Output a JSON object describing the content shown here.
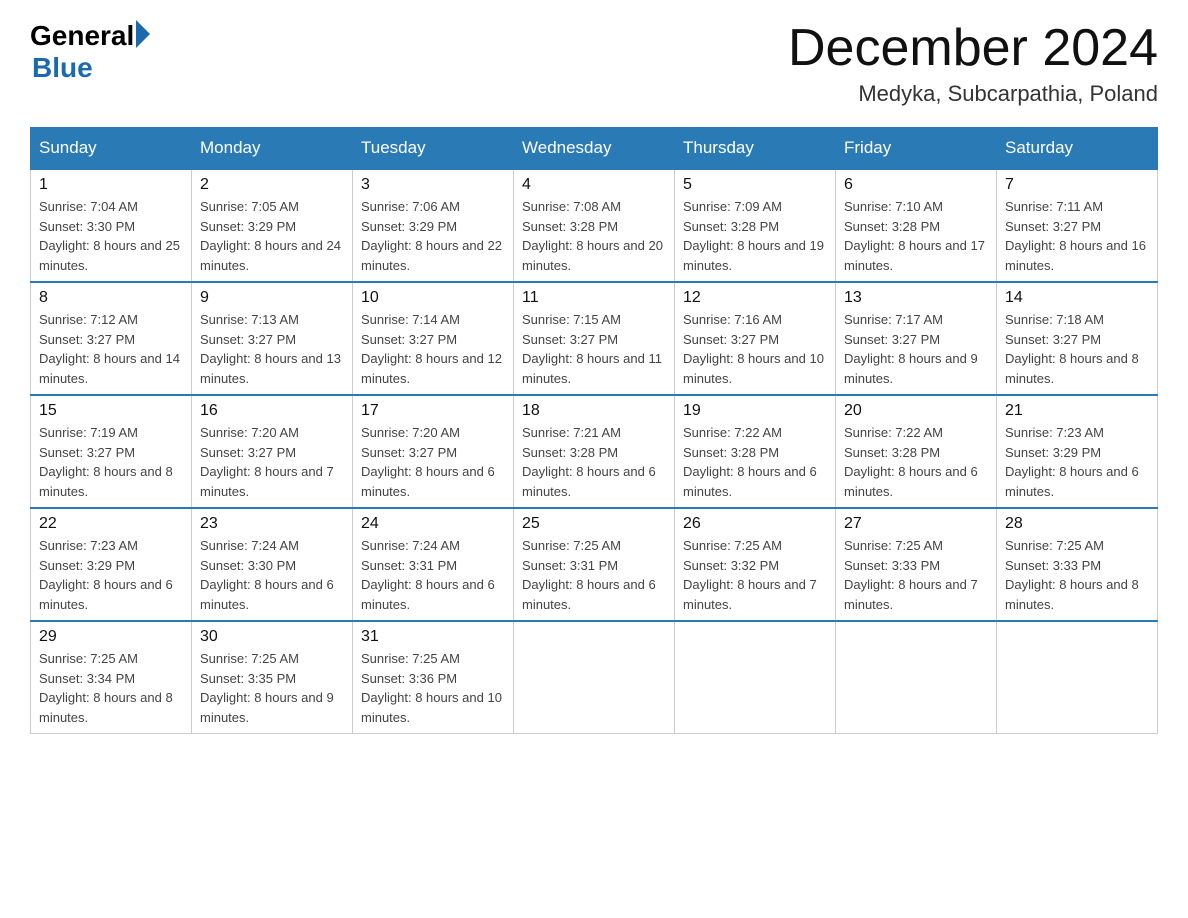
{
  "header": {
    "logo_general": "General",
    "logo_blue": "Blue",
    "month_title": "December 2024",
    "location": "Medyka, Subcarpathia, Poland"
  },
  "days_of_week": [
    "Sunday",
    "Monday",
    "Tuesday",
    "Wednesday",
    "Thursday",
    "Friday",
    "Saturday"
  ],
  "weeks": [
    [
      {
        "day": "1",
        "sunrise": "7:04 AM",
        "sunset": "3:30 PM",
        "daylight": "8 hours and 25 minutes."
      },
      {
        "day": "2",
        "sunrise": "7:05 AM",
        "sunset": "3:29 PM",
        "daylight": "8 hours and 24 minutes."
      },
      {
        "day": "3",
        "sunrise": "7:06 AM",
        "sunset": "3:29 PM",
        "daylight": "8 hours and 22 minutes."
      },
      {
        "day": "4",
        "sunrise": "7:08 AM",
        "sunset": "3:28 PM",
        "daylight": "8 hours and 20 minutes."
      },
      {
        "day": "5",
        "sunrise": "7:09 AM",
        "sunset": "3:28 PM",
        "daylight": "8 hours and 19 minutes."
      },
      {
        "day": "6",
        "sunrise": "7:10 AM",
        "sunset": "3:28 PM",
        "daylight": "8 hours and 17 minutes."
      },
      {
        "day": "7",
        "sunrise": "7:11 AM",
        "sunset": "3:27 PM",
        "daylight": "8 hours and 16 minutes."
      }
    ],
    [
      {
        "day": "8",
        "sunrise": "7:12 AM",
        "sunset": "3:27 PM",
        "daylight": "8 hours and 14 minutes."
      },
      {
        "day": "9",
        "sunrise": "7:13 AM",
        "sunset": "3:27 PM",
        "daylight": "8 hours and 13 minutes."
      },
      {
        "day": "10",
        "sunrise": "7:14 AM",
        "sunset": "3:27 PM",
        "daylight": "8 hours and 12 minutes."
      },
      {
        "day": "11",
        "sunrise": "7:15 AM",
        "sunset": "3:27 PM",
        "daylight": "8 hours and 11 minutes."
      },
      {
        "day": "12",
        "sunrise": "7:16 AM",
        "sunset": "3:27 PM",
        "daylight": "8 hours and 10 minutes."
      },
      {
        "day": "13",
        "sunrise": "7:17 AM",
        "sunset": "3:27 PM",
        "daylight": "8 hours and 9 minutes."
      },
      {
        "day": "14",
        "sunrise": "7:18 AM",
        "sunset": "3:27 PM",
        "daylight": "8 hours and 8 minutes."
      }
    ],
    [
      {
        "day": "15",
        "sunrise": "7:19 AM",
        "sunset": "3:27 PM",
        "daylight": "8 hours and 8 minutes."
      },
      {
        "day": "16",
        "sunrise": "7:20 AM",
        "sunset": "3:27 PM",
        "daylight": "8 hours and 7 minutes."
      },
      {
        "day": "17",
        "sunrise": "7:20 AM",
        "sunset": "3:27 PM",
        "daylight": "8 hours and 6 minutes."
      },
      {
        "day": "18",
        "sunrise": "7:21 AM",
        "sunset": "3:28 PM",
        "daylight": "8 hours and 6 minutes."
      },
      {
        "day": "19",
        "sunrise": "7:22 AM",
        "sunset": "3:28 PM",
        "daylight": "8 hours and 6 minutes."
      },
      {
        "day": "20",
        "sunrise": "7:22 AM",
        "sunset": "3:28 PM",
        "daylight": "8 hours and 6 minutes."
      },
      {
        "day": "21",
        "sunrise": "7:23 AM",
        "sunset": "3:29 PM",
        "daylight": "8 hours and 6 minutes."
      }
    ],
    [
      {
        "day": "22",
        "sunrise": "7:23 AM",
        "sunset": "3:29 PM",
        "daylight": "8 hours and 6 minutes."
      },
      {
        "day": "23",
        "sunrise": "7:24 AM",
        "sunset": "3:30 PM",
        "daylight": "8 hours and 6 minutes."
      },
      {
        "day": "24",
        "sunrise": "7:24 AM",
        "sunset": "3:31 PM",
        "daylight": "8 hours and 6 minutes."
      },
      {
        "day": "25",
        "sunrise": "7:25 AM",
        "sunset": "3:31 PM",
        "daylight": "8 hours and 6 minutes."
      },
      {
        "day": "26",
        "sunrise": "7:25 AM",
        "sunset": "3:32 PM",
        "daylight": "8 hours and 7 minutes."
      },
      {
        "day": "27",
        "sunrise": "7:25 AM",
        "sunset": "3:33 PM",
        "daylight": "8 hours and 7 minutes."
      },
      {
        "day": "28",
        "sunrise": "7:25 AM",
        "sunset": "3:33 PM",
        "daylight": "8 hours and 8 minutes."
      }
    ],
    [
      {
        "day": "29",
        "sunrise": "7:25 AM",
        "sunset": "3:34 PM",
        "daylight": "8 hours and 8 minutes."
      },
      {
        "day": "30",
        "sunrise": "7:25 AM",
        "sunset": "3:35 PM",
        "daylight": "8 hours and 9 minutes."
      },
      {
        "day": "31",
        "sunrise": "7:25 AM",
        "sunset": "3:36 PM",
        "daylight": "8 hours and 10 minutes."
      },
      null,
      null,
      null,
      null
    ]
  ],
  "labels": {
    "sunrise": "Sunrise: ",
    "sunset": "Sunset: ",
    "daylight": "Daylight: "
  }
}
